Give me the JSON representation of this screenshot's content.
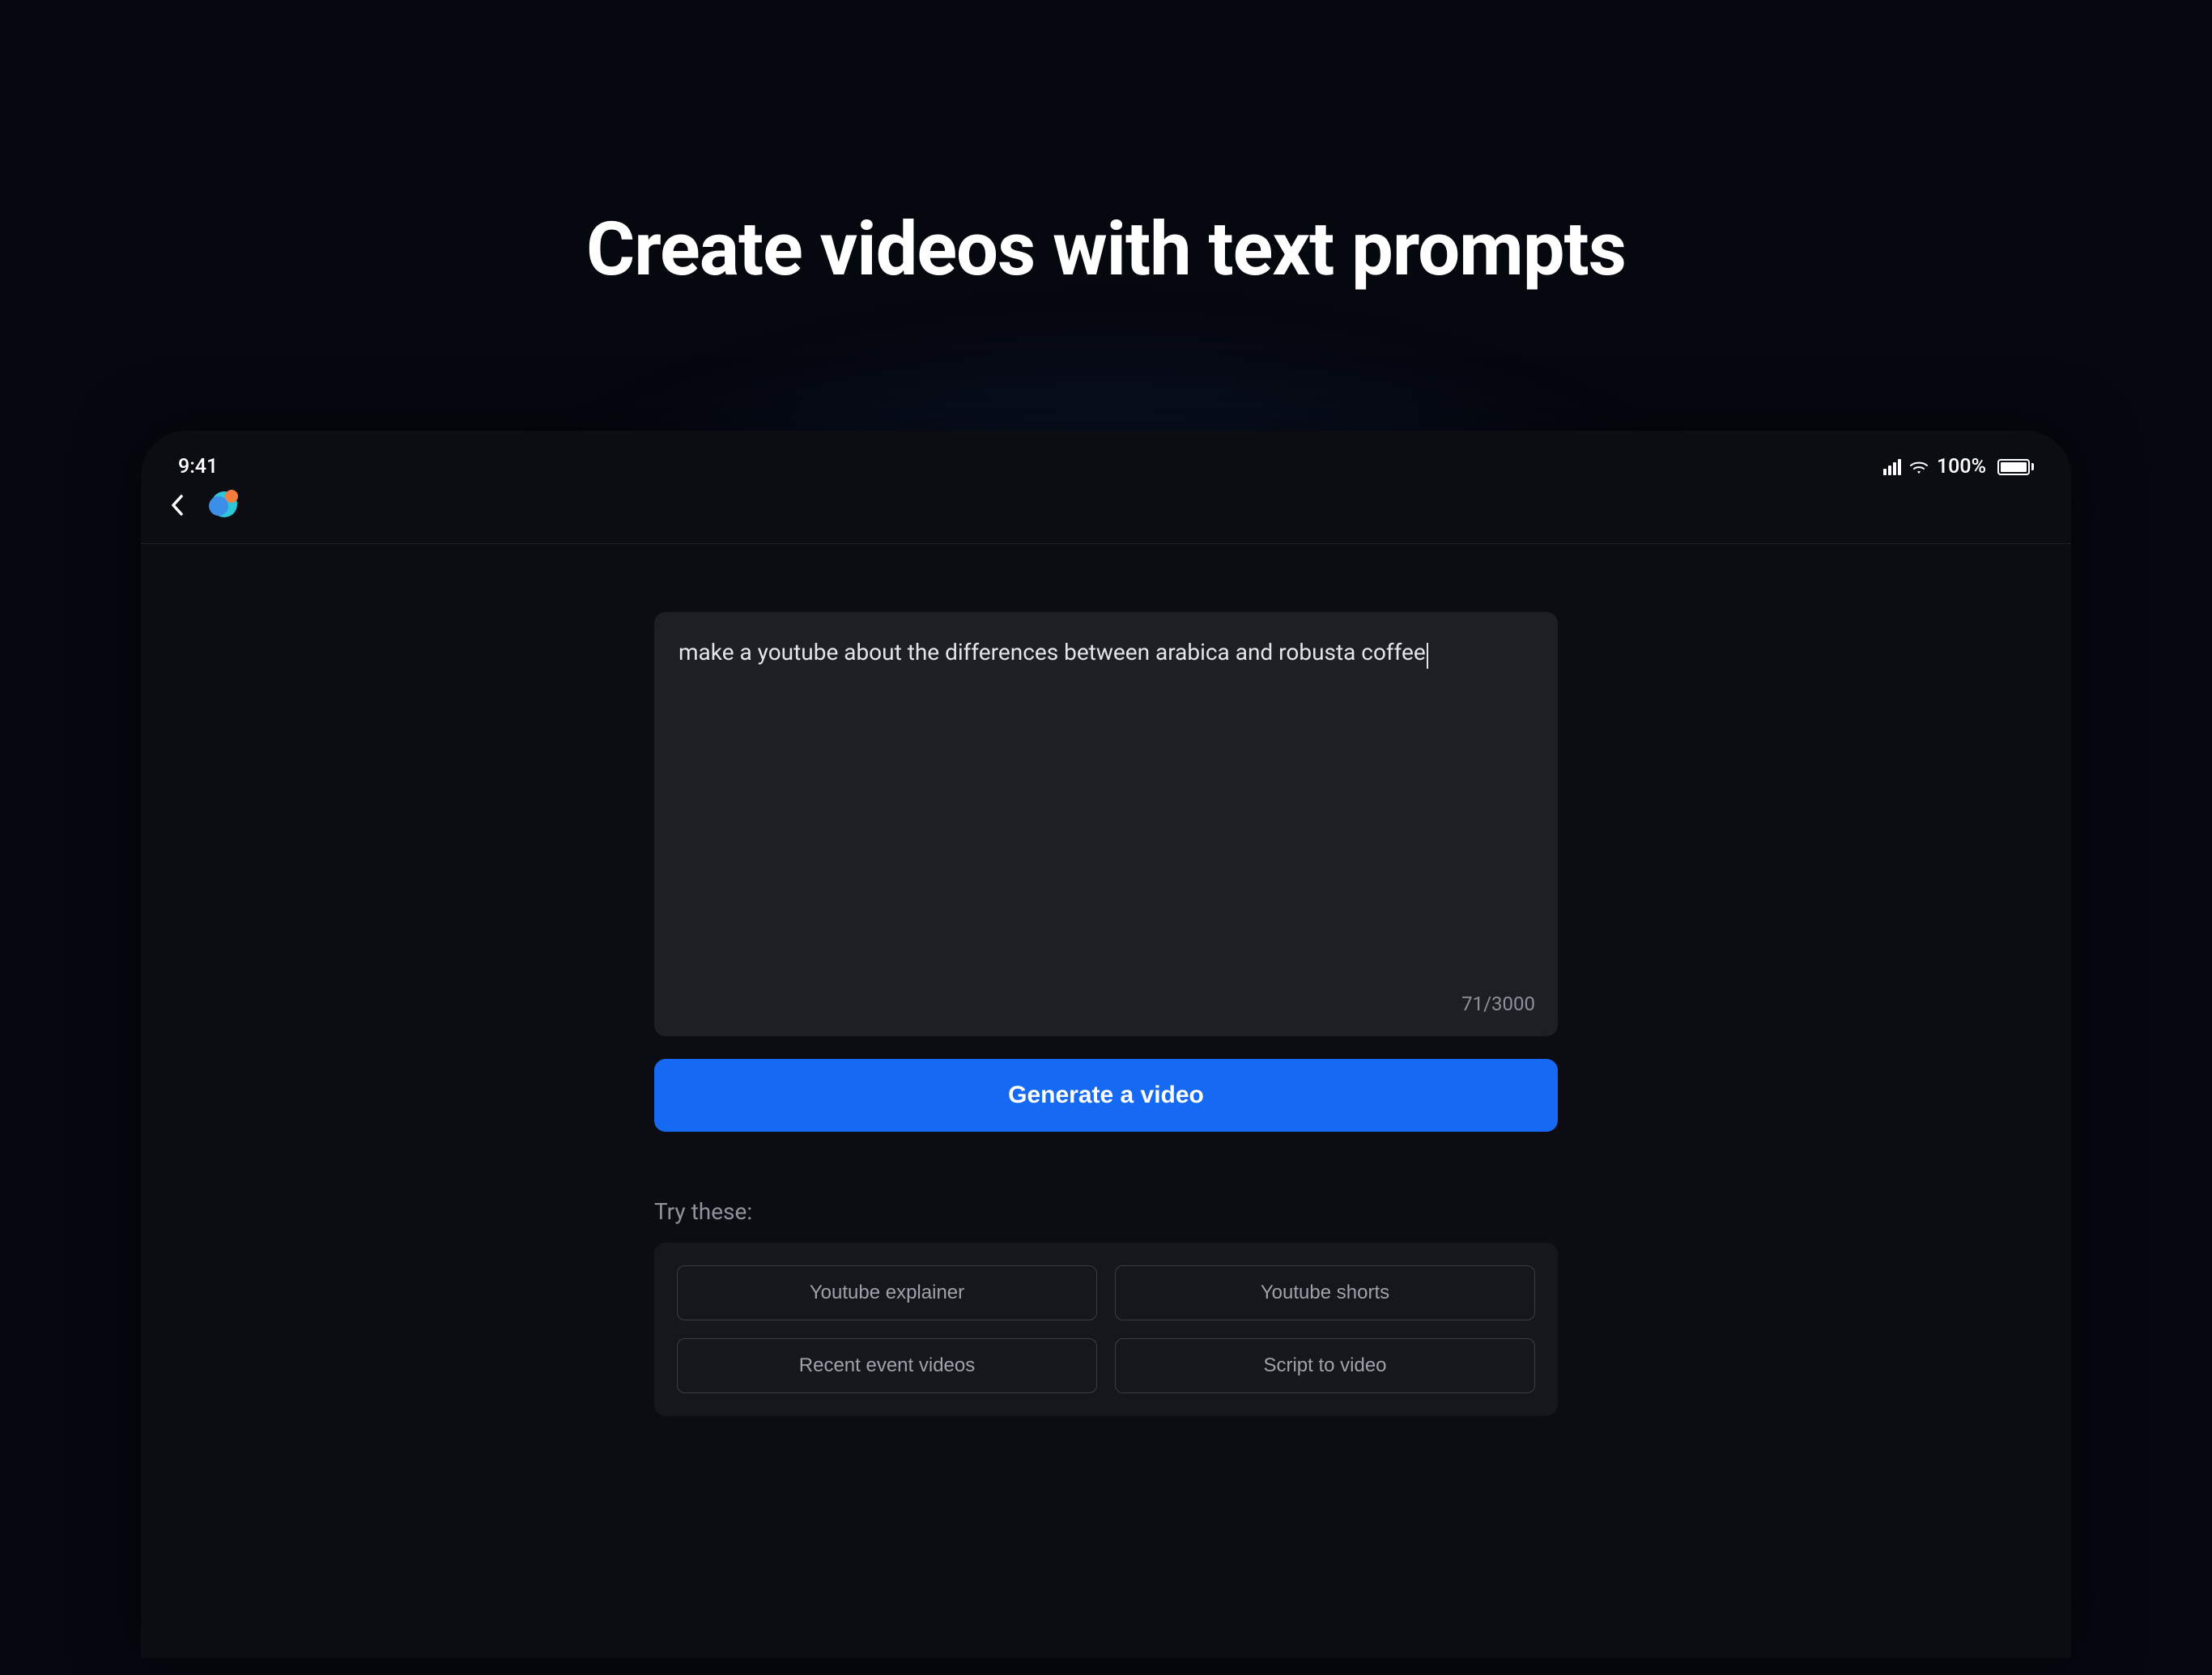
{
  "headline": "Create videos with text prompts",
  "status_bar": {
    "time": "9:41",
    "battery_label": "100%"
  },
  "prompt": {
    "text": "make a youtube about the differences between arabica and robusta coffee",
    "char_count": "71/3000"
  },
  "actions": {
    "generate_label": "Generate a video"
  },
  "suggestions": {
    "heading": "Try these:",
    "items": [
      "Youtube explainer",
      "Youtube shorts",
      "Recent event videos",
      "Script to video"
    ]
  }
}
